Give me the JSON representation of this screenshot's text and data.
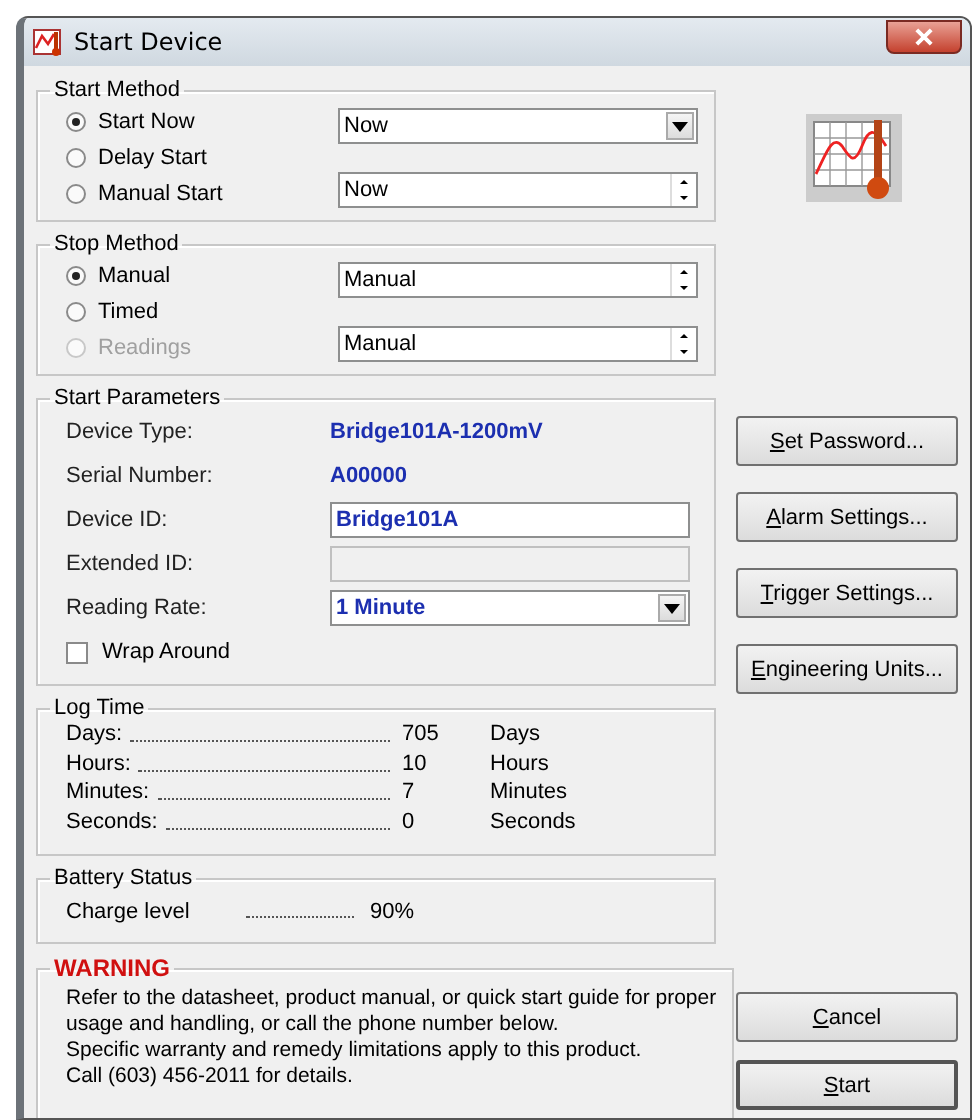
{
  "window": {
    "title": "Start Device"
  },
  "start_method": {
    "title": "Start Method",
    "options": [
      {
        "label": "Start Now",
        "selected": true,
        "disabled": false
      },
      {
        "label": "Delay Start",
        "selected": false,
        "disabled": false
      },
      {
        "label": "Manual Start",
        "selected": false,
        "disabled": false
      }
    ],
    "controls": [
      {
        "kind": "dropdown",
        "value": "Now"
      },
      {
        "kind": "spin",
        "value": "Now"
      }
    ]
  },
  "stop_method": {
    "title": "Stop Method",
    "options": [
      {
        "label": "Manual",
        "selected": true,
        "disabled": false
      },
      {
        "label": "Timed",
        "selected": false,
        "disabled": false
      },
      {
        "label": "Readings",
        "selected": false,
        "disabled": true
      }
    ],
    "controls": [
      {
        "kind": "spin",
        "value": "Manual"
      },
      {
        "kind": "spin",
        "value": "Manual"
      }
    ]
  },
  "start_parameters": {
    "title": "Start Parameters",
    "rows": [
      {
        "label": "Device Type:",
        "kind": "info",
        "value": "Bridge101A-1200mV"
      },
      {
        "label": "Serial Number:",
        "kind": "info",
        "value": "A00000"
      },
      {
        "label": "Device ID:",
        "kind": "input",
        "value": "Bridge101A",
        "disabled": false
      },
      {
        "label": "Extended ID:",
        "kind": "input",
        "disabled": true
      },
      {
        "label": "Reading Rate:",
        "kind": "dropdown",
        "value": "1 Minute"
      }
    ],
    "wrap_around": {
      "label": "Wrap Around",
      "checked": false
    }
  },
  "log_time": {
    "title": "Log Time",
    "rows": [
      {
        "label": "Days:",
        "value": "705",
        "unit": "Days"
      },
      {
        "label": "Hours:",
        "value": "10",
        "unit": "Hours"
      },
      {
        "label": "Minutes:",
        "value": "7",
        "unit": "Minutes"
      },
      {
        "label": "Seconds:",
        "value": "0",
        "unit": "Seconds"
      }
    ]
  },
  "battery": {
    "title": "Battery Status",
    "label": "Charge level",
    "value": "90%"
  },
  "warning": {
    "title": "WARNING",
    "lines": [
      "Refer to the datasheet, product manual, or quick start guide for proper",
      "usage and handling, or call the phone number below.",
      "Specific warranty and remedy limitations apply to this product.",
      "Call (603) 456-2011 for details."
    ]
  },
  "side_buttons": [
    {
      "label": "Set Password...",
      "mnemonic": true
    },
    {
      "label": "Alarm Settings...",
      "mnemonic": true
    },
    {
      "label": "Trigger Settings...",
      "mnemonic": true
    },
    {
      "label": "Engineering Units...",
      "mnemonic": true
    }
  ],
  "bottom_buttons": [
    {
      "label": "Cancel",
      "mnemonic": true,
      "default": false
    },
    {
      "label": "Start",
      "mnemonic": true,
      "default": true
    }
  ]
}
